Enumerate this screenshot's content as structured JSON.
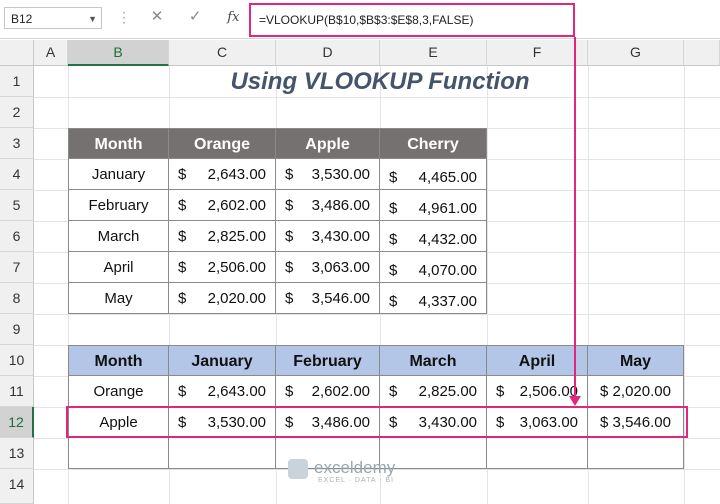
{
  "name_box": "B12",
  "formula": "=VLOOKUP(B$10,$B$3:$E$8,3,FALSE)",
  "formula_icons": [
    "cancel-icon",
    "enter-icon",
    "function-icon"
  ],
  "fx_label": "fx",
  "columns": [
    "A",
    "B",
    "C",
    "D",
    "E",
    "F",
    "G"
  ],
  "rows": [
    "1",
    "2",
    "3",
    "4",
    "5",
    "6",
    "7",
    "8",
    "9",
    "10",
    "11",
    "12",
    "13",
    "14"
  ],
  "selected_column": "B",
  "selected_row": "12",
  "title": "Using VLOOKUP Function",
  "table1": {
    "headers": [
      "Month",
      "Orange",
      "Apple",
      "Cherry"
    ],
    "rows": [
      [
        "January",
        "$",
        "2,643.00",
        "$",
        "3,530.00",
        "$",
        "4,465.00"
      ],
      [
        "February",
        "$",
        "2,602.00",
        "$",
        "3,486.00",
        "$",
        "4,961.00"
      ],
      [
        "March",
        "$",
        "2,825.00",
        "$",
        "3,430.00",
        "$",
        "4,432.00"
      ],
      [
        "April",
        "$",
        "2,506.00",
        "$",
        "3,063.00",
        "$",
        "4,070.00"
      ],
      [
        "May",
        "$",
        "2,020.00",
        "$",
        "3,546.00",
        "$",
        "4,337.00"
      ]
    ]
  },
  "table2": {
    "headers": [
      "Month",
      "January",
      "February",
      "March",
      "April",
      "May"
    ],
    "rows": [
      [
        "Orange",
        "$",
        "2,643.00",
        "$",
        "2,602.00",
        "$",
        "2,825.00",
        "$",
        "2,506.00",
        "$ 2,020.00"
      ],
      [
        "Apple",
        "$",
        "3,530.00",
        "$",
        "3,486.00",
        "$",
        "3,430.00",
        "$",
        "3,063.00",
        "$ 3,546.00"
      ]
    ]
  },
  "watermark": {
    "name": "exceldemy",
    "tagline": "EXCEL · DATA · BI"
  },
  "colors": {
    "accent": "#e0277d",
    "header_dark": "#757171",
    "header_blue": "#b4c6e7",
    "title": "#44546a"
  }
}
